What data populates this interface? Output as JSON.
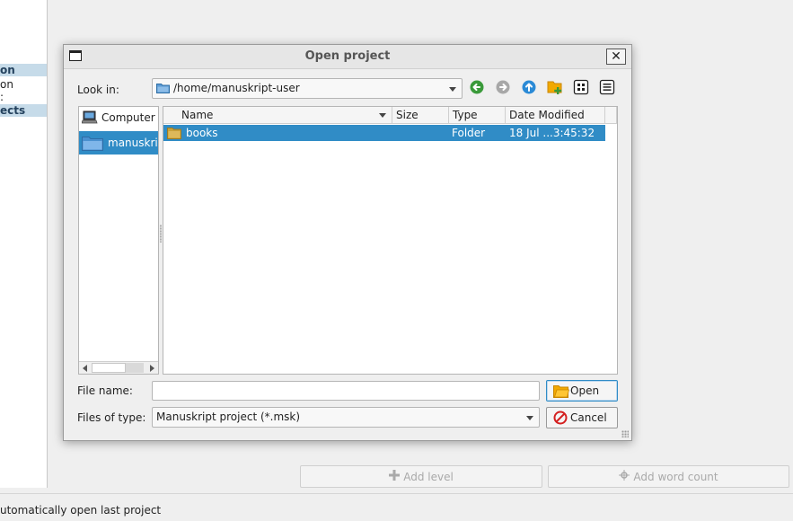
{
  "background": {
    "sidebar_items": [
      {
        "label": "on",
        "highlighted": true
      },
      {
        "label": "on",
        "highlighted": false
      },
      {
        "label": ":",
        "highlighted": false
      },
      {
        "label": "ects",
        "highlighted": true
      }
    ],
    "add_level_label": "Add level",
    "add_word_count_label": "Add word count",
    "status_text": "utomatically open last project"
  },
  "dialog": {
    "title": "Open project",
    "look_in_label": "Look in:",
    "look_in_value": "/home/manuskript-user",
    "toolbar": {
      "back_icon": "back-arrow-icon",
      "forward_icon": "forward-arrow-icon",
      "parent_icon": "parent-directory-icon",
      "new_folder_icon": "new-folder-icon",
      "list_view_icon": "list-view-icon",
      "detail_view_icon": "detail-view-icon"
    },
    "sidebar": [
      {
        "label": "Computer",
        "icon": "computer-icon",
        "selected": false
      },
      {
        "label": "manuskript",
        "icon": "folder-icon",
        "selected": true
      }
    ],
    "columns": [
      "Name",
      "Size",
      "Type",
      "Date Modified"
    ],
    "rows": [
      {
        "name": "books",
        "size": "",
        "type": "Folder",
        "modified": "18 Jul ...3:45:32",
        "selected": true
      }
    ],
    "file_name_label": "File name:",
    "file_name_value": "",
    "files_of_type_label": "Files of type:",
    "files_of_type_value": "Manuskript project (*.msk)",
    "open_label": "Open",
    "cancel_label": "Cancel"
  },
  "colors": {
    "selection": "#308cc6",
    "dialog_bg": "#efefef"
  }
}
